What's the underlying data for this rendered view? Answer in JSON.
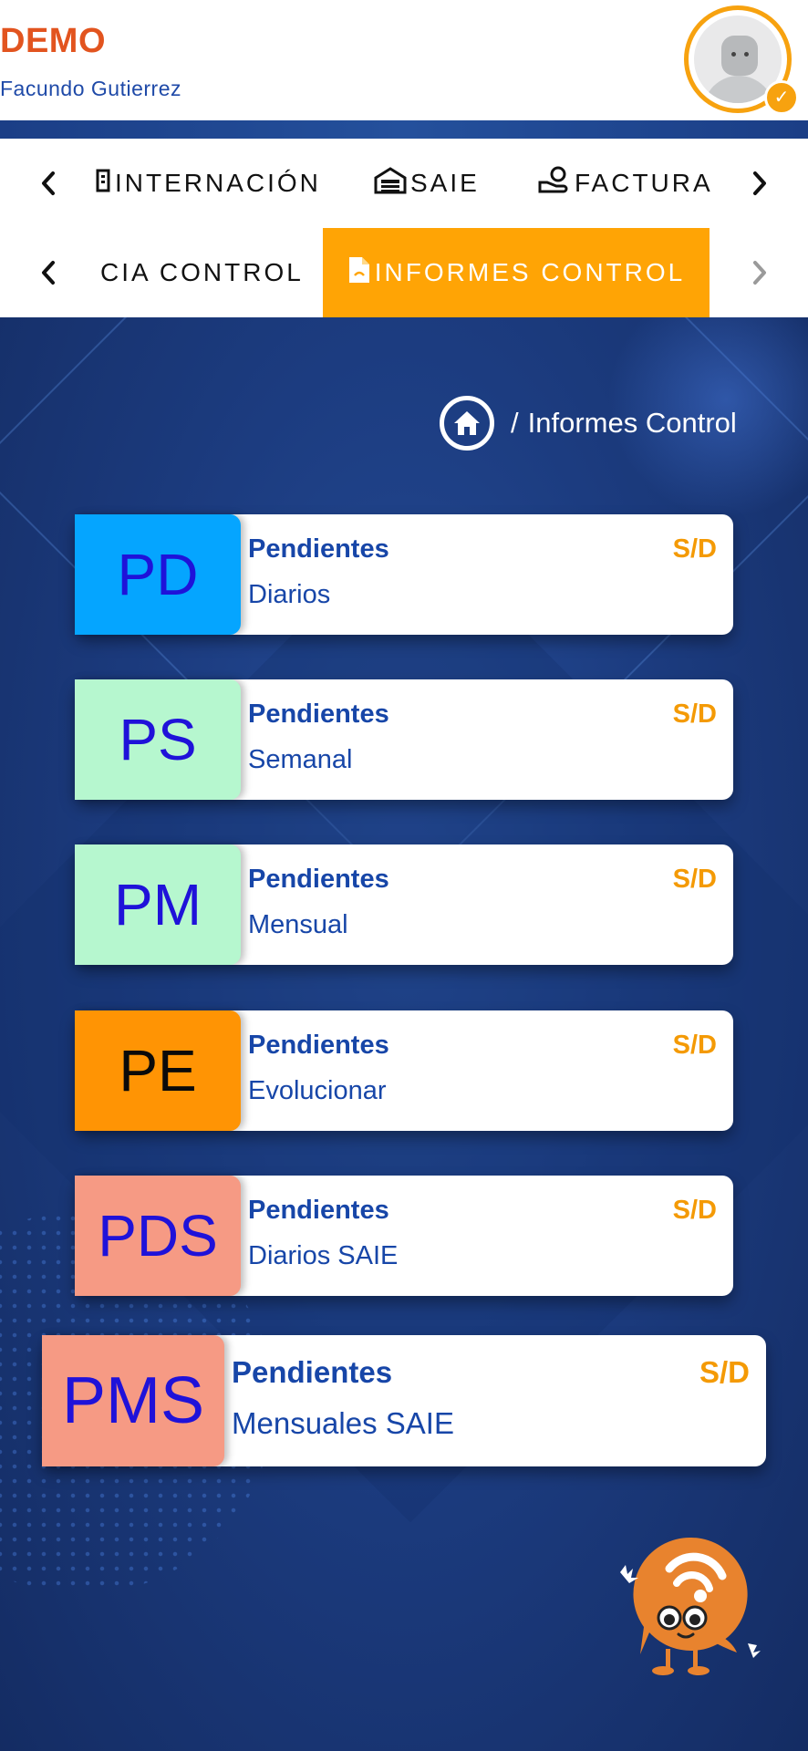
{
  "header": {
    "brand": "DEMO",
    "username": "Facundo Gutierrez"
  },
  "nav_top": {
    "items": [
      "INTERNACIÓN",
      "SAIE",
      "FACTURA"
    ]
  },
  "nav_bottom": {
    "items": [
      "CIA CONTROL",
      "INFORMES CONTROL"
    ],
    "active": "INFORMES CONTROL"
  },
  "breadcrumb": {
    "separator": "/",
    "current": "Informes Control"
  },
  "cards": [
    {
      "code": "PD",
      "title": "Pendientes",
      "subtitle": "Diarios",
      "value": "S/D",
      "badge_color": "#05a5ff",
      "code_color": "#1f12d9"
    },
    {
      "code": "PS",
      "title": "Pendientes",
      "subtitle": "Semanal",
      "value": "S/D",
      "badge_color": "#b6f7cf",
      "code_color": "#1f12d9"
    },
    {
      "code": "PM",
      "title": "Pendientes",
      "subtitle": "Mensual",
      "value": "S/D",
      "badge_color": "#b6f7cf",
      "code_color": "#1f12d9"
    },
    {
      "code": "PE",
      "title": "Pendientes",
      "subtitle": "Evolucionar",
      "value": "S/D",
      "badge_color": "#ff9404",
      "code_color": "#0a0a0a"
    },
    {
      "code": "PDS",
      "title": "Pendientes",
      "subtitle": "Diarios SAIE",
      "value": "S/D",
      "badge_color": "#f69a84",
      "code_color": "#1f12d9"
    },
    {
      "code": "PMS",
      "title": "Pendientes",
      "subtitle": "Mensuales SAIE",
      "value": "S/D",
      "badge_color": "#f69a84",
      "code_color": "#1f12d9"
    }
  ],
  "icons": {
    "nav_prev": "chevron-left-icon",
    "nav_next": "chevron-right-icon",
    "internacion": "building-icon",
    "saie": "warehouse-icon",
    "factura": "hand-coin-icon",
    "informes": "file-icon",
    "home": "home-icon",
    "verified": "check-icon"
  },
  "colors": {
    "brand": "#e2541f",
    "accent": "#ffa405",
    "primary_text": "#1746a8"
  }
}
